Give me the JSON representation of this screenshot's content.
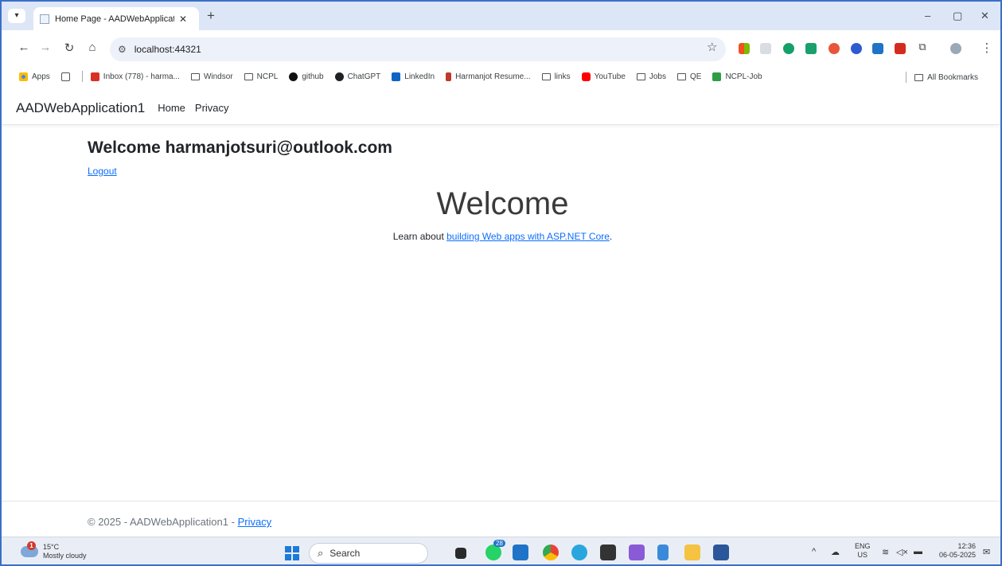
{
  "browser": {
    "tab_title": "Home Page - AADWebApplicati",
    "url": "localhost:44321",
    "window_controls": {
      "minimize": "–",
      "restore": "▢",
      "close": "✕"
    }
  },
  "bookmarks": {
    "items": [
      {
        "label": "Apps",
        "icon": "apps-grid-icon",
        "color": "#4285f4"
      },
      {
        "label": "",
        "icon": "tab-groups-icon",
        "color": "#555555"
      },
      {
        "label": "Inbox (778) - harma...",
        "icon": "gmail-icon",
        "color": "#d93025"
      },
      {
        "label": "Windsor",
        "icon": "folder-icon"
      },
      {
        "label": "NCPL",
        "icon": "folder-icon"
      },
      {
        "label": "github",
        "icon": "github-icon",
        "color": "#111111"
      },
      {
        "label": "ChatGPT",
        "icon": "chatgpt-icon",
        "color": "#202124"
      },
      {
        "label": "LinkedIn",
        "icon": "linkedin-icon",
        "color": "#0a66c2"
      },
      {
        "label": "Harmanjot Resume...",
        "icon": "resume-icon",
        "color": "#c0392b"
      },
      {
        "label": "links",
        "icon": "folder-icon"
      },
      {
        "label": "YouTube",
        "icon": "youtube-icon",
        "color": "#ff0000"
      },
      {
        "label": "Jobs",
        "icon": "folder-icon"
      },
      {
        "label": "QE",
        "icon": "folder-icon"
      },
      {
        "label": "NCPL-Job",
        "icon": "ncpl-icon",
        "color": "#2e9e44"
      }
    ],
    "all_bookmarks": "All Bookmarks"
  },
  "app": {
    "brand": "AADWebApplication1",
    "nav": [
      "Home",
      "Privacy"
    ],
    "welcome_user": "Welcome harmanjotsuri@outlook.com",
    "logout": "Logout",
    "hero": "Welcome",
    "learn_prefix": "Learn about ",
    "learn_link": "building Web apps with ASP.NET Core",
    "learn_suffix": ".",
    "footer_text": "© 2025 - AADWebApplication1 - ",
    "footer_link": "Privacy"
  },
  "taskbar": {
    "weather_temp": "15°C",
    "weather_desc": "Mostly cloudy",
    "weather_badge": "1",
    "search_placeholder": "Search",
    "whatsapp_badge": "28",
    "lang_top": "ENG",
    "lang_bottom": "US",
    "time": "12:36",
    "date": "06-05-2025"
  }
}
